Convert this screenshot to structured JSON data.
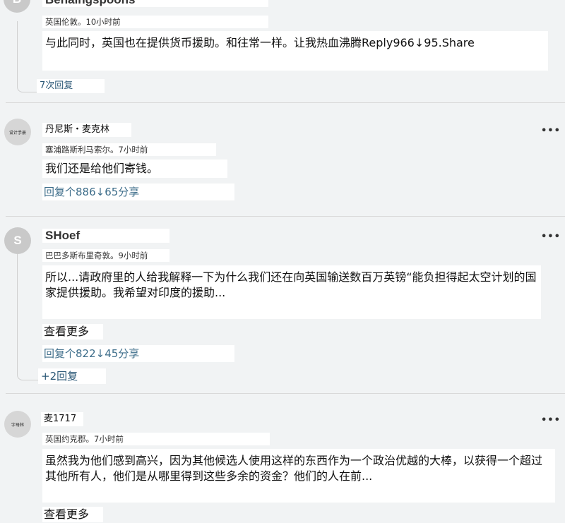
{
  "comments": [
    {
      "name": "Benaingspoons",
      "avatar_letter": "B",
      "meta": "英国伦敦。10小时前",
      "text": "与此同时，英国也在提供货币援助。和往常一样。让我热血沸腾Reply966↓95.Share",
      "replies": "7次回复"
    },
    {
      "name": "丹尼斯・麦克林",
      "avatar_label": "设计手册",
      "meta": "塞浦路斯利马索尔。7小时前",
      "text": "我们还是给他们寄钱。",
      "actions": "回复个886↓65分享",
      "menu": "•••"
    },
    {
      "name": "SHoef",
      "avatar_letter": "S",
      "meta": "巴巴多斯布里奇敦。9小时前",
      "text": "所以...请政府里的人给我解释一下为什么我们还在向英国输送数百万英镑“能负担得起太空计划的国家提供援助。我希望对印度的援助...",
      "more": "查看更多",
      "actions": "回复个822↓45分享",
      "replies": "+2回复",
      "menu": "•••"
    },
    {
      "name": "麦1717",
      "avatar_label": "字母林",
      "meta": "英国约克郡。7小时前",
      "text": "虽然我为他们感到高兴，因为其他候选人使用这样的东西作为一个政治优越的大棒，以获得一个超过其他所有人，他们是从哪里得到这些多余的资金？他们的人在前...",
      "more": "查看更多",
      "menu": "•••"
    }
  ]
}
